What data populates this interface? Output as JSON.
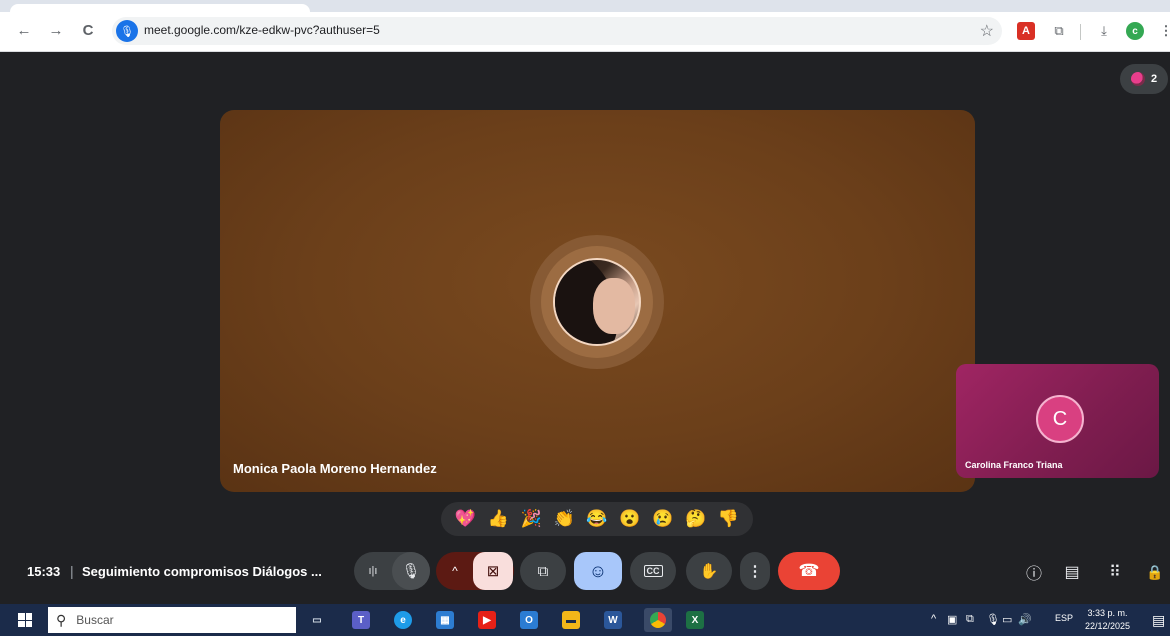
{
  "browser": {
    "url": "meet.google.com/kze-edkw-pvc?authuser=5",
    "back_glyph": "←",
    "forward_glyph": "→",
    "reload_glyph": "C",
    "bookmark_glyph": "☆",
    "profile_initial": "c",
    "menu_glyph": "⋮"
  },
  "meet": {
    "participant_count": "2",
    "main_tile_name": "Monica Paola Moreno Hernandez",
    "side_tile_name": "Carolina Franco Triana",
    "side_avatar_initial": "C",
    "reactions": [
      "💖",
      "👍",
      "🎉",
      "👏",
      "😂",
      "😮",
      "😢",
      "🤔",
      "👎"
    ],
    "meeting_time": "15:33",
    "meeting_separator": "|",
    "meeting_title": "Seguimiento compromisos Diálogos ...",
    "controls": {
      "mic_level_glyph": "ı|ı",
      "mic_glyph": "🎙",
      "camera_options_glyph": "^",
      "camera_off_glyph": "⊠",
      "present_glyph": "⧉",
      "emoji_glyph": "☺",
      "captions_glyph": "CC",
      "raise_hand_glyph": "✋",
      "more_glyph": "⋮",
      "leave_glyph": "☎"
    },
    "right_controls": {
      "info_glyph": "ⓘ",
      "chat_glyph": "▤",
      "activities_glyph": "⠿",
      "host_controls_glyph": "🔒"
    }
  },
  "taskbar": {
    "search_placeholder": "Buscar",
    "language": "ESP",
    "time": "3:33 p. m.",
    "date": "22/12/2025"
  },
  "colors": {
    "meet_background": "#202124",
    "main_tile": "#6b3f1a",
    "side_tile": "#a02563",
    "leave_button": "#ea4335",
    "emoji_button": "#a8c7fa",
    "camera_off": "#f9dedc",
    "taskbar": "#1b2b4a"
  }
}
